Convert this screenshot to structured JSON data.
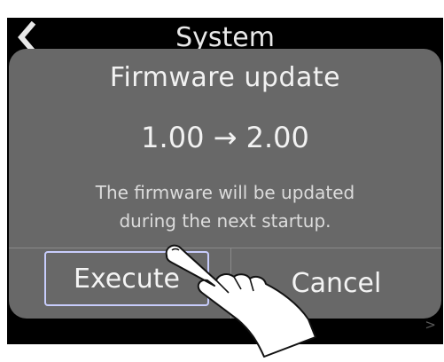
{
  "header": {
    "title": "System",
    "back_icon": "chevron-left-icon"
  },
  "dialog": {
    "title": "Firmware update",
    "version": "1.00 → 2.00",
    "message_line1": "The firmware will be updated",
    "message_line2": "during the next startup.",
    "execute_label": "Execute",
    "cancel_label": "Cancel"
  },
  "footer": {
    "next_glyph": ">"
  },
  "colors": {
    "screen_bg": "#000000",
    "dialog_bg": "#686868",
    "text": "#f2f2f2",
    "selection_outline": "#c8cdfc"
  }
}
